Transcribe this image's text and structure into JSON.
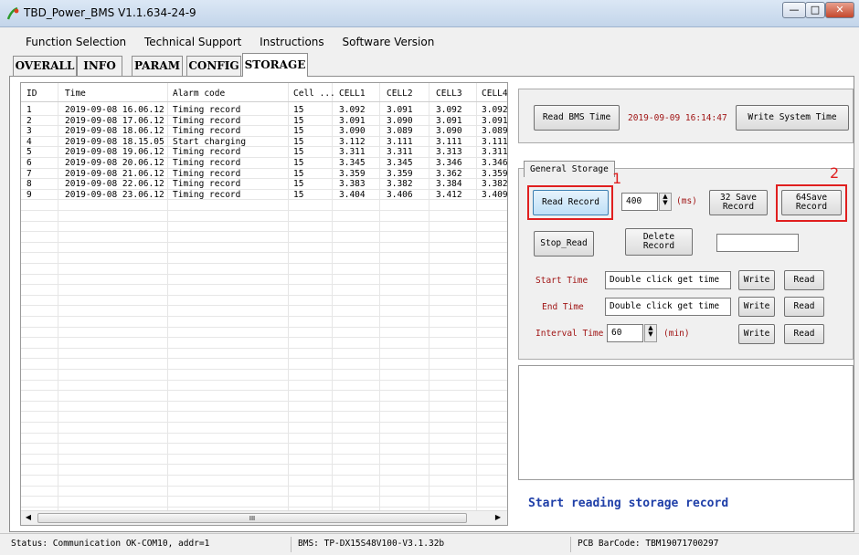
{
  "window": {
    "title": "TBD_Power_BMS V1.1.634-24-9"
  },
  "menu": [
    "Function Selection",
    "Technical Support",
    "Instructions",
    "Software Version"
  ],
  "tabs": [
    "OVERALL",
    "INFO",
    "PARAM",
    "CONFIG",
    "STORAGE"
  ],
  "table": {
    "columns": [
      "ID",
      "Time",
      "Alarm code",
      "Cell ...",
      "CELL1",
      "CELL2",
      "CELL3",
      "CELL4"
    ],
    "rows": [
      [
        "1",
        "2019-09-08 16.06.12",
        "Timing record",
        "15",
        "3.092",
        "3.091",
        "3.092",
        "3.092"
      ],
      [
        "2",
        "2019-09-08 17.06.12",
        "Timing record",
        "15",
        "3.091",
        "3.090",
        "3.091",
        "3.091"
      ],
      [
        "3",
        "2019-09-08 18.06.12",
        "Timing record",
        "15",
        "3.090",
        "3.089",
        "3.090",
        "3.089"
      ],
      [
        "4",
        "2019-09-08 18.15.05",
        "Start charging",
        "15",
        "3.112",
        "3.111",
        "3.111",
        "3.111"
      ],
      [
        "5",
        "2019-09-08 19.06.12",
        "Timing record",
        "15",
        "3.311",
        "3.311",
        "3.313",
        "3.311"
      ],
      [
        "6",
        "2019-09-08 20.06.12",
        "Timing record",
        "15",
        "3.345",
        "3.345",
        "3.346",
        "3.346"
      ],
      [
        "7",
        "2019-09-08 21.06.12",
        "Timing record",
        "15",
        "3.359",
        "3.359",
        "3.362",
        "3.359"
      ],
      [
        "8",
        "2019-09-08 22.06.12",
        "Timing record",
        "15",
        "3.383",
        "3.382",
        "3.384",
        "3.382"
      ],
      [
        "9",
        "2019-09-08 23.06.12",
        "Timing record",
        "15",
        "3.404",
        "3.406",
        "3.412",
        "3.409"
      ]
    ],
    "scroll_glyph": "III"
  },
  "time_panel": {
    "read_button": "Read BMS Time",
    "time_value": "2019-09-09 16:14:47",
    "write_button": "Write System Time"
  },
  "storage": {
    "group_title": "General Storage",
    "read_record_button": "Read Record",
    "interval_ms_value": "400",
    "ms_unit": "(ms)",
    "save32_button": "32 Save Record",
    "save64_button": "64Save Record",
    "stop_read_button": "Stop_Read",
    "delete_record_button": "Delete Record",
    "delete_field_value": "",
    "start_time_label": "Start Time",
    "start_time_value": "Double click get time",
    "end_time_label": "End Time",
    "end_time_value": "Double click get time",
    "interval_label": "Interval Time",
    "interval_value": "60",
    "interval_unit": "(min)",
    "write_label": "Write",
    "read_label": "Read",
    "callout_1": "1",
    "callout_2": "2"
  },
  "log_message": "Start reading storage record",
  "statusbar": {
    "status": "Status: Communication OK-COM10, addr=1",
    "bms": "BMS: TP-DX15S48V100-V3.1.32b",
    "barcode": "PCB BarCode: TBM19071700297"
  },
  "colors": {
    "callout": "#e01f1f",
    "time_text": "#a01414",
    "log_text": "#1f3fa8"
  }
}
